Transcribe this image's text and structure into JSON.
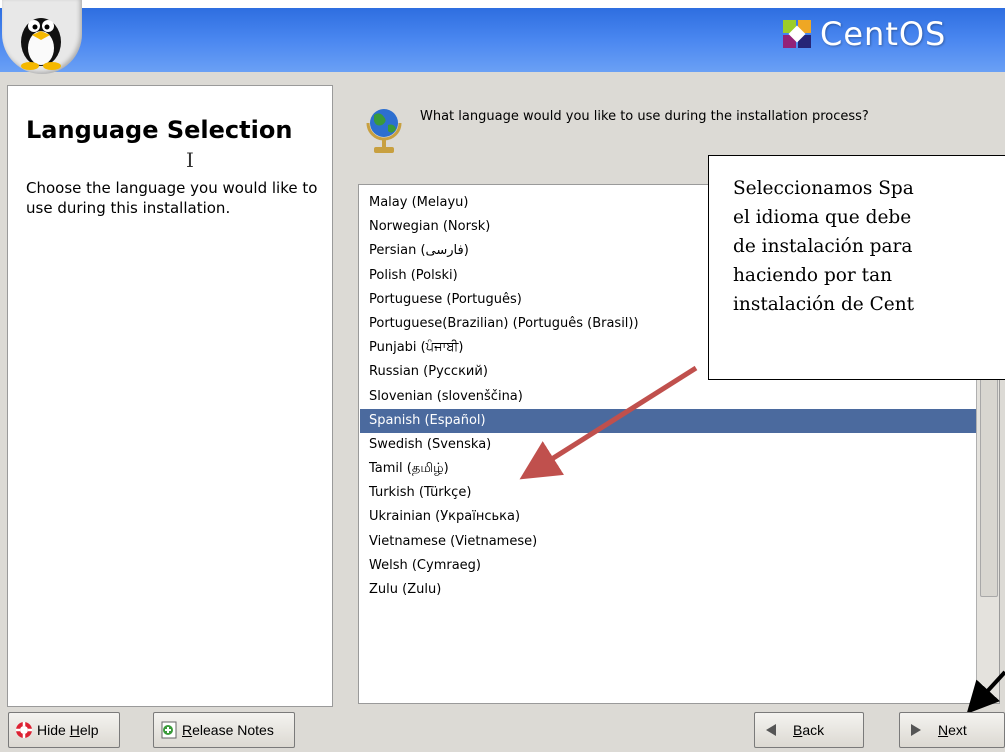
{
  "header": {
    "logo_text": "CentOS"
  },
  "help": {
    "title": "Language Selection",
    "text": "Choose the language you would like to use during this installation."
  },
  "question": "What language would you like to use during the installation process?",
  "languages": [
    "Malay (Melayu)",
    "Norwegian (Norsk)",
    "Persian (فارسی)",
    "Polish (Polski)",
    "Portuguese (Português)",
    "Portuguese(Brazilian) (Português (Brasil))",
    "Punjabi (ਪੰਜਾਬੀ)",
    "Russian (Русский)",
    "Slovenian (slovenščina)",
    "Spanish (Español)",
    "Swedish (Svenska)",
    "Tamil (தமிழ்)",
    "Turkish (Türkçe)",
    "Ukrainian (Українська)",
    "Vietnamese (Vietnamese)",
    "Welsh (Cymraeg)",
    "Zulu (Zulu)"
  ],
  "selected_language": "Spanish (Español)",
  "callout": {
    "text": "Seleccionamos Spa\nel idioma que debe\nde instalación para\nhaciendo por tan\ninstalación de Cent"
  },
  "buttons": {
    "hide_help": {
      "prefix": "Hide ",
      "mnemonic": "H",
      "rest": "elp"
    },
    "release_notes": {
      "prefix": "",
      "mnemonic": "R",
      "rest": "elease Notes"
    },
    "back": {
      "prefix": "",
      "mnemonic": "B",
      "rest": "ack"
    },
    "next": {
      "prefix": "",
      "mnemonic": "N",
      "rest": "ext"
    }
  },
  "colors": {
    "header_blue": "#3d7be8",
    "selection": "#4b6a9e",
    "arrow": "#c0504d"
  }
}
